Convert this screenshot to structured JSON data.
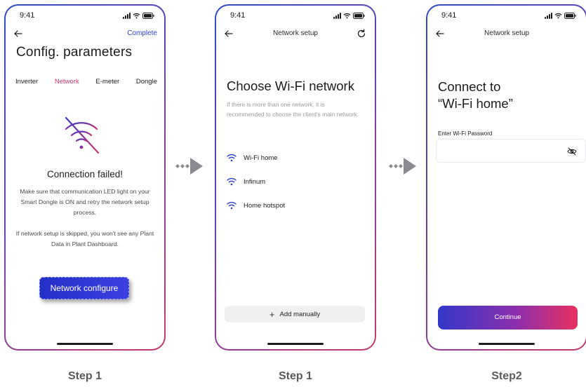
{
  "colors": {
    "accent_blue": "#2d3fd0",
    "accent_pink": "#d0356b",
    "frame_gradient": [
      "#2f4cc4",
      "#c43a6a"
    ],
    "arrow": "#8a8a90"
  },
  "status_bar": {
    "time": "9:41"
  },
  "screen1": {
    "complete_label": "Complete",
    "title": "Config. parameters",
    "tabs": [
      {
        "label": "Inverter",
        "active": false
      },
      {
        "label": "Network",
        "active": true
      },
      {
        "label": "E-meter",
        "active": false
      },
      {
        "label": "Dongle",
        "active": false
      }
    ],
    "status_icon": "wifi-off-icon",
    "fail_title": "Connection failed!",
    "fail_text_1": "Make sure that communication LED light on your Smart Dongle is ON and retry the network setup process.",
    "fail_text_2": "If network setup is skipped, you won't see any Plant Data in Plant Dashboard.",
    "configure_button": "Network configure"
  },
  "screen2": {
    "nav_title": "Network setup",
    "title": "Choose Wi-Fi network",
    "hint": "If there is more than one network, it is recommended to choose the client's main network.",
    "networks": [
      "Wi-Fi home",
      "Infinum",
      "Home hotspot"
    ],
    "add_button": "Add manually"
  },
  "screen3": {
    "nav_title": "Network setup",
    "title_line_1": "Connect to",
    "title_line_2": "“Wi-Fi home”",
    "password_label": "Enter Wi-Fi Password",
    "password_value": "",
    "continue_button": "Continue"
  },
  "steps": [
    "Step 1",
    "Step 1",
    "Step2"
  ]
}
